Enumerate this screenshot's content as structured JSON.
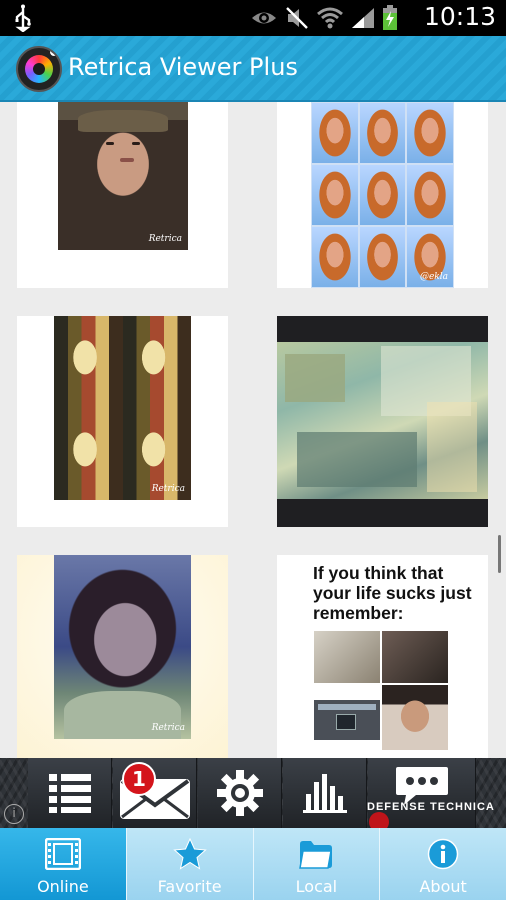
{
  "status_bar": {
    "time": "10:13",
    "icons": [
      "usb-icon",
      "eye-icon",
      "mute-icon",
      "wifi-icon",
      "signal-icon",
      "battery-charging-icon"
    ]
  },
  "action_bar": {
    "title": "Retrica Viewer Plus",
    "logo": "retrica-logo-icon"
  },
  "grid": {
    "tiles": [
      {
        "kind": "photo",
        "watermark": "Retrica"
      },
      {
        "kind": "photo",
        "watermark": "@ekla"
      },
      {
        "kind": "photo",
        "watermark": "Retrica"
      },
      {
        "kind": "photo"
      },
      {
        "kind": "photo",
        "watermark": "Retrica"
      },
      {
        "kind": "photo",
        "caption": "If you think that your life sucks just remember:"
      }
    ]
  },
  "banner_ad": {
    "badge_count": "1",
    "brand": "DEFENSE TECHNICA",
    "icons": [
      "list-icon",
      "mail-icon",
      "gear-icon",
      "bar-chart-icon",
      "chat-icon"
    ]
  },
  "tabs": [
    {
      "label": "Online",
      "icon": "film-icon",
      "active": true
    },
    {
      "label": "Favorite",
      "icon": "star-icon",
      "active": false
    },
    {
      "label": "Local",
      "icon": "folder-icon",
      "active": false
    },
    {
      "label": "About",
      "icon": "info-icon",
      "active": false
    }
  ],
  "colors": {
    "action_bar": "#2aa9d9",
    "tab_active": "#1397d4",
    "tab_inactive": "#9ad3ef"
  }
}
